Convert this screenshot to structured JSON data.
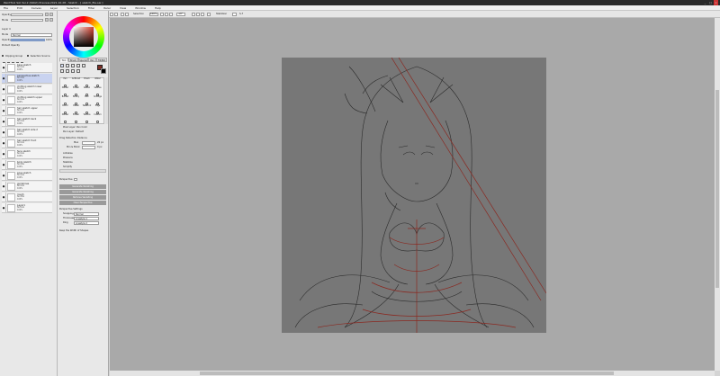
{
  "titlebar": {
    "title": "PaintTool SAI Ver.2 (64bit) Preview.2021.10.28 - Sketch - [ sketch_file.sai ]",
    "min": "_",
    "max": "□",
    "close": "×"
  },
  "menubar": {
    "items": [
      "File",
      "Edit",
      "Canvas",
      "Layer",
      "Selection",
      "Filter",
      "Ruler",
      "View",
      "Window",
      "Help"
    ]
  },
  "toolbar": {
    "selection": "Selection",
    "zoom": "100%",
    "angle": "+0°",
    "stabilizer_label": "Stabilizer",
    "stabilizer_value": "S-7"
  },
  "left": {
    "color_hex": "#7d2f27",
    "opacity_label": "Opacity",
    "opacity_value": "100%",
    "blend_label": "Mode",
    "blend_value": "Normal",
    "folder_label": "Layer 4",
    "protect_label": "Protect Opacity",
    "clip_label": "Clipping Group",
    "selection_source": "Selection Source",
    "layers": [
      {
        "name": "base sketch",
        "mode": "Normal",
        "opacity": "100%",
        "selected": false
      },
      {
        "name": "perspective sketch",
        "mode": "Normal",
        "opacity": "100%",
        "selected": true
      },
      {
        "name": "clothing sketch lower",
        "mode": "Normal",
        "opacity": "100%",
        "selected": false
      },
      {
        "name": "clothing sketch upper",
        "mode": "Normal",
        "opacity": "100%",
        "selected": false
      },
      {
        "name": "hair sketch upper",
        "mode": "Normal",
        "opacity": "100%",
        "selected": false
      },
      {
        "name": "hair sketch back",
        "mode": "Normal",
        "opacity": "100%",
        "selected": false
      },
      {
        "name": "hair sketch side 2",
        "mode": "Normal",
        "opacity": "100%",
        "selected": false
      },
      {
        "name": "hair sketch front",
        "mode": "Normal",
        "opacity": "100%",
        "selected": false
      },
      {
        "name": "face sketch",
        "mode": "Normal",
        "opacity": "100%",
        "selected": false
      },
      {
        "name": "body sketch",
        "mode": "Normal",
        "opacity": "100%",
        "selected": false
      },
      {
        "name": "pose sketch",
        "mode": "Normal",
        "opacity": "100%",
        "selected": false
      },
      {
        "name": "guidelines",
        "mode": "Normal",
        "opacity": "100%",
        "selected": false
      },
      {
        "name": "rough",
        "mode": "Normal",
        "opacity": "100%",
        "selected": false
      },
      {
        "name": "Layer1",
        "mode": "Normal",
        "opacity": "100%",
        "selected": false
      }
    ]
  },
  "mid": {
    "tabs": [
      "Tool",
      "Brush",
      "Special",
      "Pen",
      "Fill/Bkt"
    ],
    "brushes": [
      {
        "name": "Pen",
        "size": "5"
      },
      {
        "name": "AirBrush",
        "size": "35"
      },
      {
        "name": "Brush",
        "size": "22"
      },
      {
        "name": "Water",
        "size": "70"
      },
      {
        "name": "Marker",
        "size": "8"
      },
      {
        "name": "Eraser",
        "size": "40"
      },
      {
        "name": "SelPen",
        "size": "16"
      },
      {
        "name": "SelEras",
        "size": "16"
      },
      {
        "name": "Bucket",
        "size": ""
      },
      {
        "name": "Binary",
        "size": "5"
      },
      {
        "name": "Blur",
        "size": "30"
      },
      {
        "name": "Smudge",
        "size": "20"
      },
      {
        "name": "Pencil",
        "size": "3"
      },
      {
        "name": "Pastel",
        "size": "25"
      },
      {
        "name": "Watercol",
        "size": "50"
      },
      {
        "name": "Edge",
        "size": "10"
      },
      {
        "name": "Marker",
        "size": "12"
      },
      {
        "name": "Eraser",
        "size": "100"
      },
      {
        "name": "Texture",
        "size": "60"
      },
      {
        "name": "Custom",
        "size": "15"
      }
    ],
    "opt1": "Pixel Layer: Pen Color",
    "opt2": "Pen Layer: Default",
    "drag_detection": "Drag Detection Distance",
    "max_label": "Max",
    "max_value": "20 px",
    "min_label": "Min & Block",
    "min_value": "0 px",
    "stroke_label": "Stroke",
    "stroke_opts": [
      "Antialias",
      "Pressure",
      "Stabilize",
      "Simplify"
    ],
    "perspective_label": "Perspective",
    "perspective_value": "0",
    "buttons": [
      "Generate Vanishing",
      "Generate Vanishing",
      "Remove Vanishing",
      "Clear Perspective"
    ],
    "settings_label": "Perspective Settings",
    "snap_label": "Snapping",
    "snap_value": "Normal",
    "thick_label": "Thickness",
    "thick_value": "Linestyle 1",
    "ring_label": "Ring",
    "ring_value": "Linestyle 2",
    "keep_label": "Keep the Width of Shapes"
  },
  "canvas": {
    "doc_bg": "#777777"
  }
}
